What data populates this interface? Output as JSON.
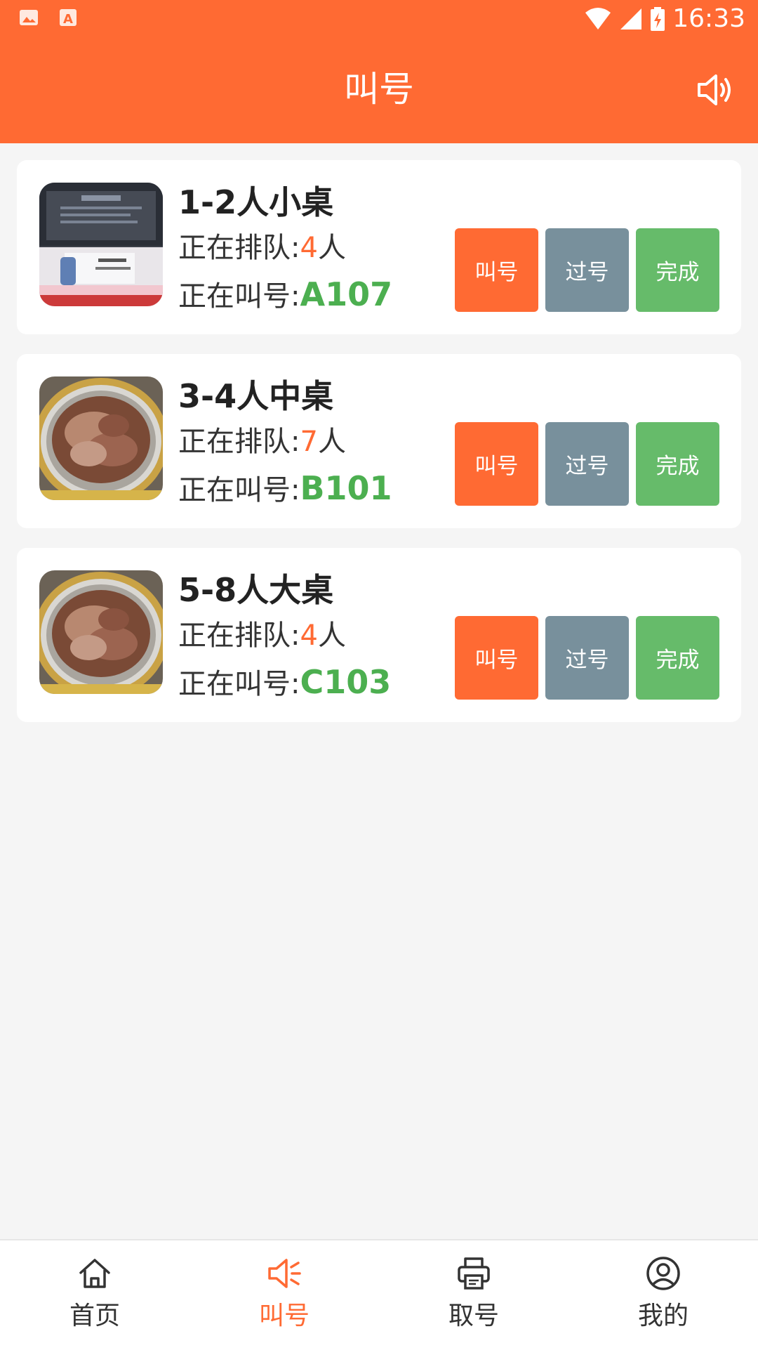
{
  "status_bar": {
    "time": "16:33",
    "left_icons": [
      "image-notification-icon",
      "text-notification-icon"
    ],
    "right_icons": [
      "wifi-icon",
      "signal-icon",
      "battery-charging-icon"
    ]
  },
  "header": {
    "title": "叫号",
    "speaker_icon": "speaker-icon",
    "color": "#ff6a33"
  },
  "queues": [
    {
      "name": "1-2人小桌",
      "queue_label": "正在排队:",
      "queue_count": "4",
      "queue_unit": "人",
      "calling_label": "正在叫号:",
      "calling_number": "A107",
      "thumb": "promo-photo"
    },
    {
      "name": "3-4人中桌",
      "queue_label": "正在排队:",
      "queue_count": "7",
      "queue_unit": "人",
      "calling_label": "正在叫号:",
      "calling_number": "B101",
      "thumb": "bbq-plate-photo"
    },
    {
      "name": "5-8人大桌",
      "queue_label": "正在排队:",
      "queue_count": "4",
      "queue_unit": "人",
      "calling_label": "正在叫号:",
      "calling_number": "C103",
      "thumb": "bbq-plate-photo"
    }
  ],
  "actions": {
    "call": "叫号",
    "pass": "过号",
    "done": "完成"
  },
  "colors": {
    "call": "#ff6a33",
    "pass": "#78909c",
    "done": "#66bb6a",
    "calling_number": "#4caf50"
  },
  "bottom_nav": [
    {
      "label": "首页",
      "icon": "home-icon"
    },
    {
      "label": "叫号",
      "icon": "megaphone-icon",
      "active": true
    },
    {
      "label": "取号",
      "icon": "printer-icon"
    },
    {
      "label": "我的",
      "icon": "profile-icon"
    }
  ]
}
